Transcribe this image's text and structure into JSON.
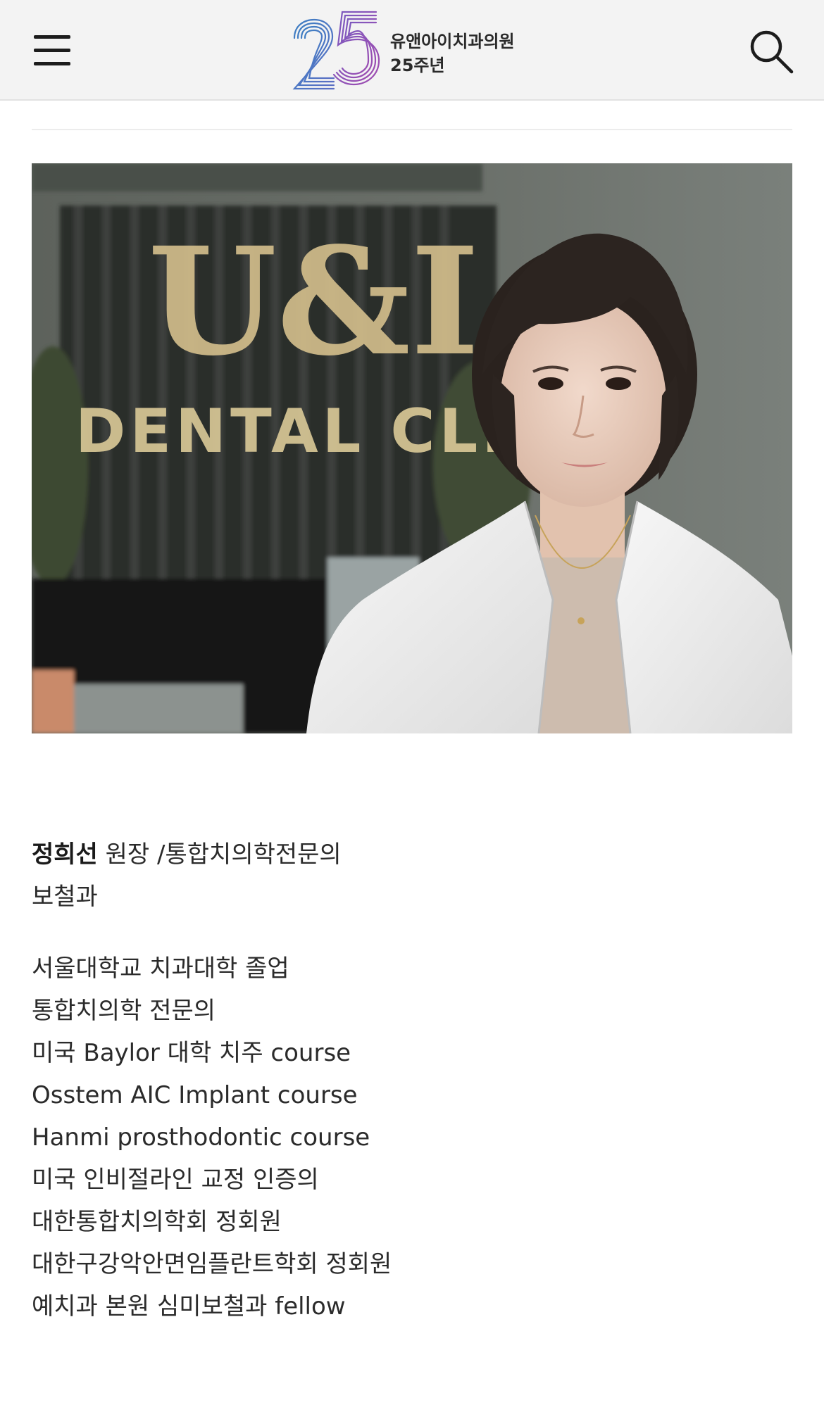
{
  "header": {
    "menu_icon": "hamburger-menu-icon",
    "logo": {
      "mark": "25",
      "line1": "유앤아이치과의원",
      "line2": "25주년"
    },
    "search_icon": "search-icon"
  },
  "photo": {
    "sign_line1": "U&I",
    "sign_line2": "DENTAL CLINIC"
  },
  "doctor": {
    "name": "정희선",
    "title": " 원장 /통합치의학전문의",
    "department": "보철과",
    "credentials": [
      "서울대학교 치과대학 졸업",
      "통합치의학 전문의",
      "미국 Baylor 대학 치주 course",
      "Osstem AIC Implant course",
      "Hanmi prosthodontic course",
      "미국 인비절라인 교정 인증의",
      "대한통합치의학회 정회원",
      "대한구강악안면임플란트학회 정회원",
      "예치과 본원 심미보철과 fellow"
    ]
  },
  "colors": {
    "header_bg": "#f3f3f3",
    "logo_blue": "#4a86c5",
    "logo_purple": "#8a4fb8",
    "text": "#2b2b2b"
  }
}
